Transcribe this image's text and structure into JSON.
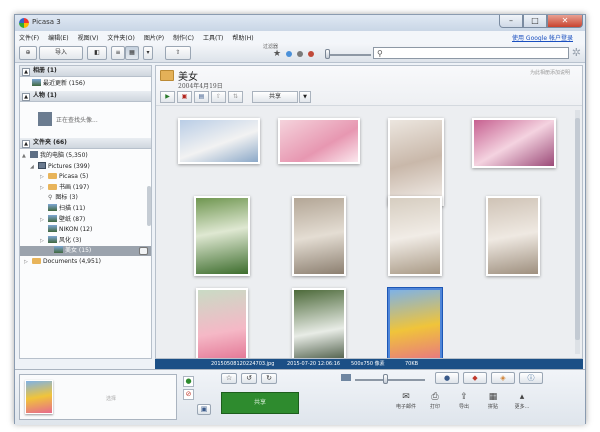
{
  "app": {
    "title": "Picasa 3"
  },
  "window_controls": {
    "minimize": "–",
    "maximize": "□",
    "close": "✕"
  },
  "menu": [
    "文件(F)",
    "编辑(E)",
    "视图(V)",
    "文件夹(O)",
    "图片(P)",
    "制作(C)",
    "工具(T)",
    "帮助(H)"
  ],
  "account_link": "使用 Google 帐户登录",
  "toolbar": {
    "import_label": "导入",
    "filter_label": "过滤器"
  },
  "sidebar": {
    "albums_header": "相册 (1)",
    "recent_album": "最近更新 (156)",
    "people_header": "人物 (1)",
    "people_status": "正在查找头像...",
    "folders_header": "文件夹 (66)",
    "tree": [
      {
        "label": "我的电脑 (5,350)",
        "icon": "computer-icon",
        "indent": 2,
        "expand": "▲"
      },
      {
        "label": "Pictures (399)",
        "icon": "pictures-folder-icon",
        "indent": 10,
        "expand": "◢"
      },
      {
        "label": "Picasa (5)",
        "icon": "folder-icon",
        "indent": 20,
        "expand": "▷"
      },
      {
        "label": "书画 (197)",
        "icon": "folder-icon",
        "indent": 20,
        "expand": "▷"
      },
      {
        "label": "图标 (3)",
        "icon": "pin-icon",
        "indent": 20,
        "expand": ""
      },
      {
        "label": "扫描 (11)",
        "icon": "photo-folder-icon",
        "indent": 20,
        "expand": ""
      },
      {
        "label": "壁纸 (87)",
        "icon": "photo-folder-icon",
        "indent": 20,
        "expand": "▷"
      },
      {
        "label": "NIKON (12)",
        "icon": "photo-folder-icon",
        "indent": 20,
        "expand": ""
      },
      {
        "label": "风化 (3)",
        "icon": "photo-folder-icon",
        "indent": 20,
        "expand": "▷"
      },
      {
        "label": "美女 (15)",
        "icon": "photo-folder-icon",
        "indent": 26,
        "expand": "",
        "selected": true
      },
      {
        "label": "Documents (4,951)",
        "icon": "folder-icon",
        "indent": 4,
        "expand": "▷"
      }
    ]
  },
  "album": {
    "title": "美女",
    "date": "2004年4月19日",
    "right_text": "为此相册添加说明",
    "share_label": "共享"
  },
  "infobar": {
    "filename": "20150508120224703.jpg",
    "datetime": "2015-07-20 12:06:16",
    "dimensions": "500x750 像素",
    "filesize": "70KB"
  },
  "bottom": {
    "tray_text": "选择",
    "green_button": "共享",
    "actions": [
      {
        "icon": "✉",
        "label": "电子邮件"
      },
      {
        "icon": "⎙",
        "label": "打印"
      },
      {
        "icon": "⇪",
        "label": "导出"
      },
      {
        "icon": "▦",
        "label": "拼贴"
      },
      {
        "icon": "▴",
        "label": "更多..."
      }
    ]
  },
  "colors": {
    "accent": "#1b4f86",
    "selection": "#4f86d9",
    "green": "#2e8b2e"
  }
}
